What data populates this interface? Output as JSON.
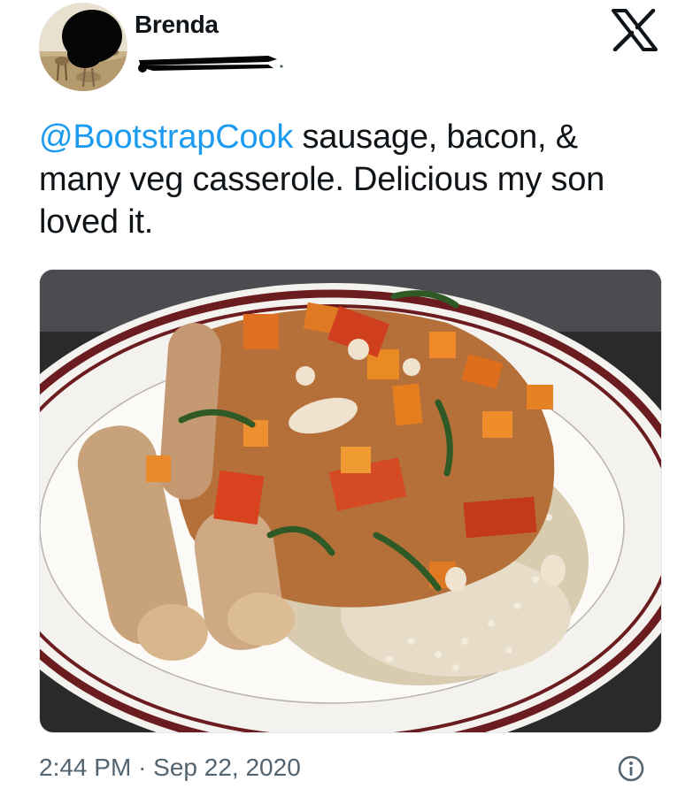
{
  "tweet": {
    "author_name": "Brenda",
    "mention": "@BootstrapCook",
    "text": " sausage, bacon, & many veg casserole. Delicious my son loved it.",
    "time": "2:44 PM",
    "separator": "·",
    "date": "Sep 22, 2020"
  },
  "icons": {
    "brand": "x-logo-icon",
    "info": "info-icon"
  },
  "colors": {
    "mention": "#1d9bf0",
    "meta_text": "#536471",
    "text": "#0f1419"
  },
  "photo": {
    "subject": "plate of casserole with sausages, vegetables and rice"
  }
}
